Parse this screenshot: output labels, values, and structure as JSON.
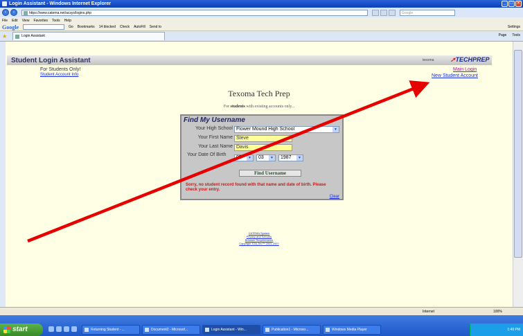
{
  "window": {
    "title": "Login Assistant - Windows Internet Explorer",
    "url": "https://www.catema.net/acsys/logins.php",
    "search_placeholder": "Google"
  },
  "menu": [
    "File",
    "Edit",
    "View",
    "Favorites",
    "Tools",
    "Help"
  ],
  "google_toolbar": {
    "logo": "Google",
    "items": [
      "Go",
      "Bookmarks",
      "14 blocked",
      "Check",
      "AutoFill",
      "Send to"
    ],
    "settings": "Settings"
  },
  "tab": {
    "label": "Login Assistant"
  },
  "tab_tools": [
    "Page",
    "Tools"
  ],
  "page": {
    "header_title": "Student Login Assistant",
    "header_user": "texoma",
    "logo_text": "TECHPREP",
    "for_students": "For Students Only!",
    "account_info_link": "Student Account Info",
    "main_login_link": "Main Login",
    "new_account_link": "New Student Account",
    "site_title": "Texoma Tech Prep",
    "subtitle_pre": "For ",
    "subtitle_bold": "students",
    "subtitle_post": " with existing accounts only...",
    "form": {
      "title": "Find My Username",
      "school_label": "Your High School",
      "school_value": "Flower Mound High School",
      "first_label": "Your First Name",
      "first_value": "Steve",
      "last_label": "Your Last Name",
      "last_value": "Davis",
      "dob_label": "Your Date Of Birth",
      "dob_month": "05",
      "dob_day": "03",
      "dob_year": "1987",
      "find_button": "Find Username",
      "error": "Sorry, no student record found with that name and date of birth. Please check your entry.",
      "clear_link": "Clear"
    },
    "footer": [
      "CATEMA System",
      "Privacy and Security",
      "Browser Requirements",
      "Copyright STA-Tec™ 2001-2007"
    ]
  },
  "statusbar": {
    "zone": "Internet",
    "zoom": "100%"
  },
  "taskbar": {
    "start": "start",
    "tasks": [
      "Returning Student - ...",
      "Document2 - Microsof...",
      "Login Assistant - Win...",
      "Publication1 - Microso...",
      "Windows Media Player"
    ],
    "time": "1:49 PM"
  },
  "colors": {
    "annotation_arrow": "#e60000",
    "page_bg": "#ffffe6",
    "error": "#c41a1a"
  }
}
